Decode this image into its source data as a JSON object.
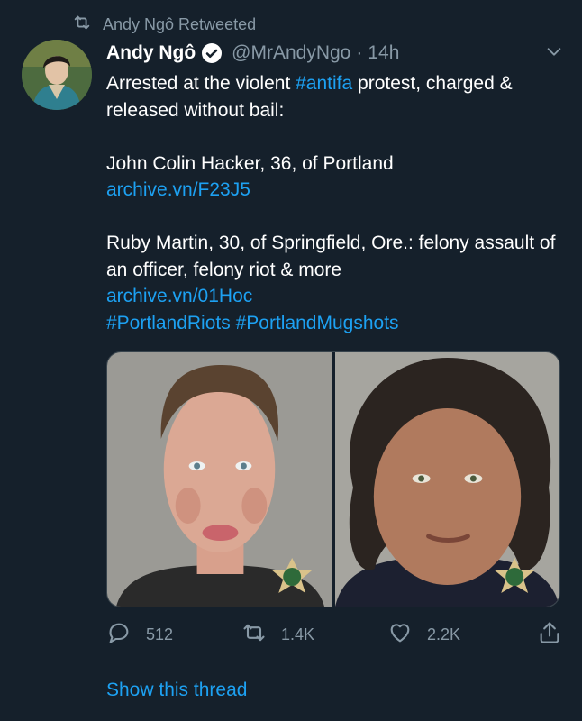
{
  "retweet": {
    "label": "Andy Ngô Retweeted"
  },
  "tweet": {
    "name": "Andy Ngô",
    "handle": "@MrAndyNgo",
    "separator": "·",
    "time": "14h",
    "line1_pre": "Arrested at the violent ",
    "line1_hashtag": "#antifa",
    "line1_post": " protest, charged & released without bail:",
    "person1": "John Colin Hacker, 36, of Portland",
    "link1": "archive.vn/F23J5",
    "person2": "Ruby Martin, 30, of Springfield, Ore.: felony assault of an officer, felony riot & more",
    "link2": "archive.vn/01Hoc",
    "hashtag1": "#PortlandRiots",
    "hashtag2": "#PortlandMugshots"
  },
  "actions": {
    "replies": "512",
    "retweets": "1.4K",
    "likes": "2.2K"
  },
  "thread": {
    "label": "Show this thread"
  },
  "colors": {
    "background": "#15202b",
    "text": "#ffffff",
    "muted": "#8899a6",
    "link": "#1da1f2"
  },
  "icons": [
    "retweet-icon",
    "verified-icon",
    "chevron-down-icon",
    "reply-icon",
    "like-icon",
    "share-icon"
  ]
}
